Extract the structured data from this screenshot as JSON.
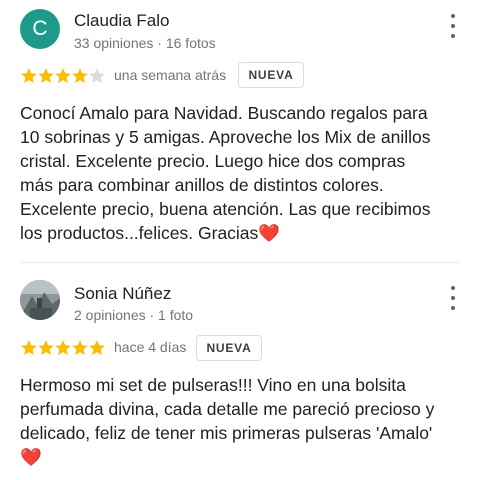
{
  "reviews": [
    {
      "author": "Claudia Falo",
      "avatar_letter": "C",
      "meta": "33 opiniones · 16 fotos",
      "rating": 4,
      "rating_max": 5,
      "time": "una semana atrás",
      "badge": "NUEVA",
      "text": "Conocí Amalo para Navidad. Buscando regalos para\n10 sobrinas y 5 amigas. Aproveche los Mix de anillos\ncristal. Excelente precio. Luego hice dos compras\nmás para combinar anillos de distintos colores.\nExcelente precio, buena atención.  Las que recibimos\nlos productos...felices.  Gracias",
      "emoji": "❤️"
    },
    {
      "author": "Sonia Núñez",
      "meta": "2 opiniones · 1 foto",
      "rating": 5,
      "rating_max": 5,
      "time": "hace 4 días",
      "badge": "NUEVA",
      "text": "Hermoso mi set de pulseras!!! Vino en una bolsita\nperfumada divina, cada detalle me pareció precioso y\ndelicado, feliz de tener mis primeras pulseras 'Amalo'",
      "emoji": "❤️"
    }
  ],
  "colors": {
    "star_filled": "#fbbc04",
    "star_empty": "#dadce0",
    "avatar_bg": "#1e9a8a",
    "heart": "#d93025"
  }
}
